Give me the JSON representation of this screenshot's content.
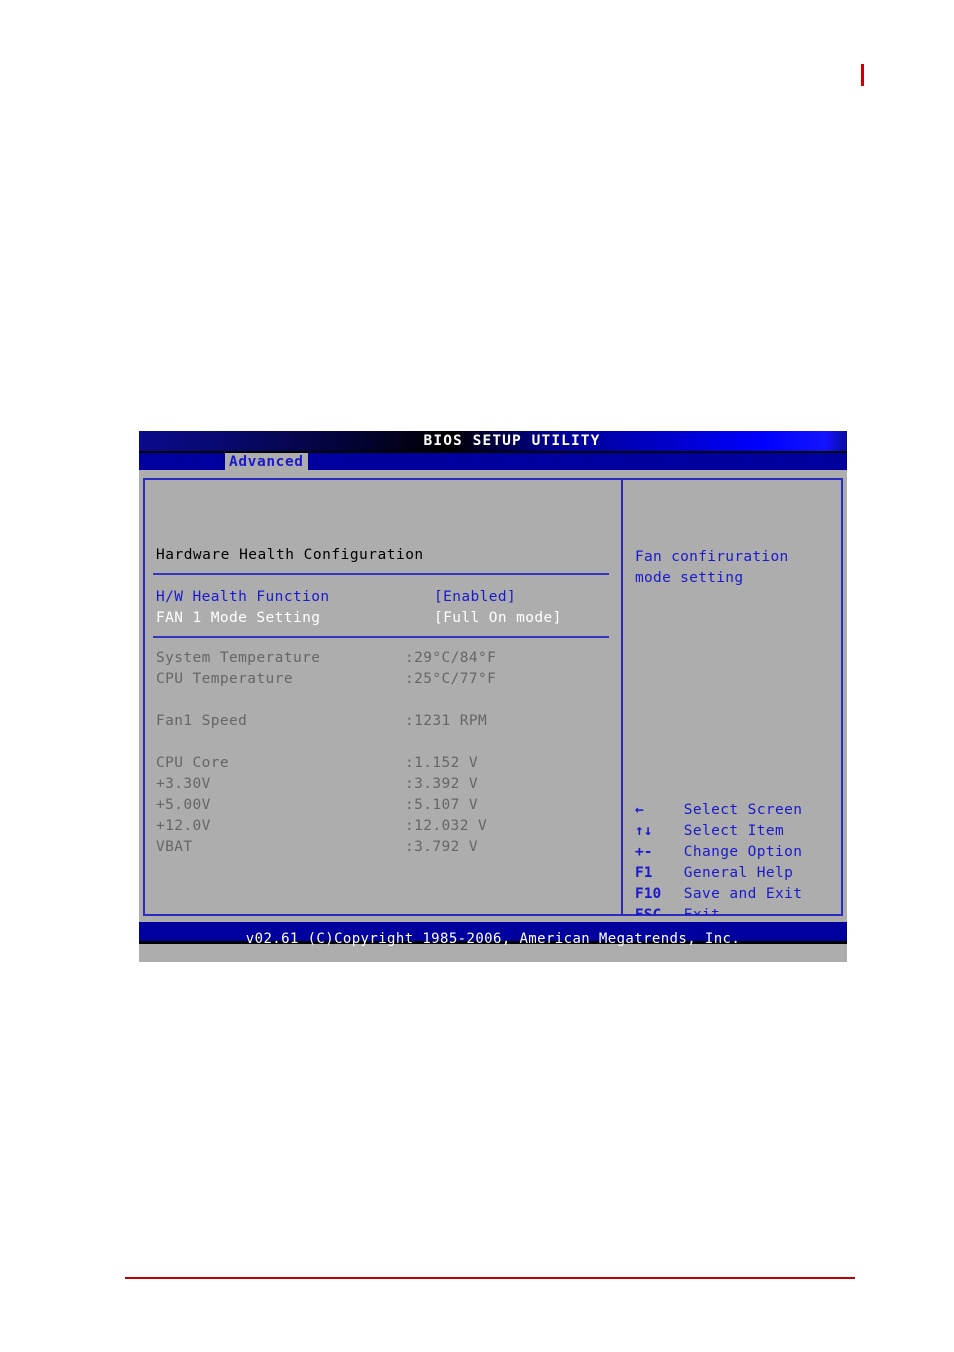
{
  "page": {
    "top_mark_color": "#cc0000",
    "bottom_rule_color": "#c00000"
  },
  "window": {
    "title": "BIOS SETUP UTILITY",
    "tab_active": "Advanced",
    "footer": "v02.61 (C)Copyright 1985-2006, American Megatrends, Inc."
  },
  "left_panel": {
    "title": "Hardware Health Configuration",
    "settings": [
      {
        "label": "H/W Health Function",
        "value": "[Enabled]",
        "style": "blue"
      },
      {
        "label": "FAN 1 Mode Setting",
        "value": "[Full On mode]",
        "style": "white"
      }
    ],
    "monitors": [
      {
        "label": "System Temperature",
        "value": ":29°C/84°F"
      },
      {
        "label": "CPU Temperature",
        "value": ":25°C/77°F"
      },
      {
        "label": "Fan1 Speed",
        "value": ":1231 RPM"
      },
      {
        "label": "CPU Core",
        "value": ":1.152 V"
      },
      {
        "label": "+3.30V",
        "value": ":3.392 V"
      },
      {
        "label": "+5.00V",
        "value": ":5.107 V"
      },
      {
        "label": "+12.0V",
        "value": ":12.032 V"
      },
      {
        "label": "VBAT",
        "value": ":3.792 V"
      }
    ]
  },
  "right_panel": {
    "help_line1": "Fan confiruration",
    "help_line2": "mode setting",
    "keys": [
      {
        "key": "←",
        "desc": "Select Screen"
      },
      {
        "key": "↑↓",
        "desc": "Select Item"
      },
      {
        "key": "+-",
        "desc": "Change Option"
      },
      {
        "key": "F1",
        "desc": "General Help"
      },
      {
        "key": "F10",
        "desc": "Save and Exit"
      },
      {
        "key": "ESC",
        "desc": "Exit"
      }
    ]
  },
  "colors": {
    "chrome_gray": "#adadad",
    "accent_blue": "#1a1acc",
    "bar_blue": "#00009e",
    "border_blue": "#2b2bbe"
  }
}
